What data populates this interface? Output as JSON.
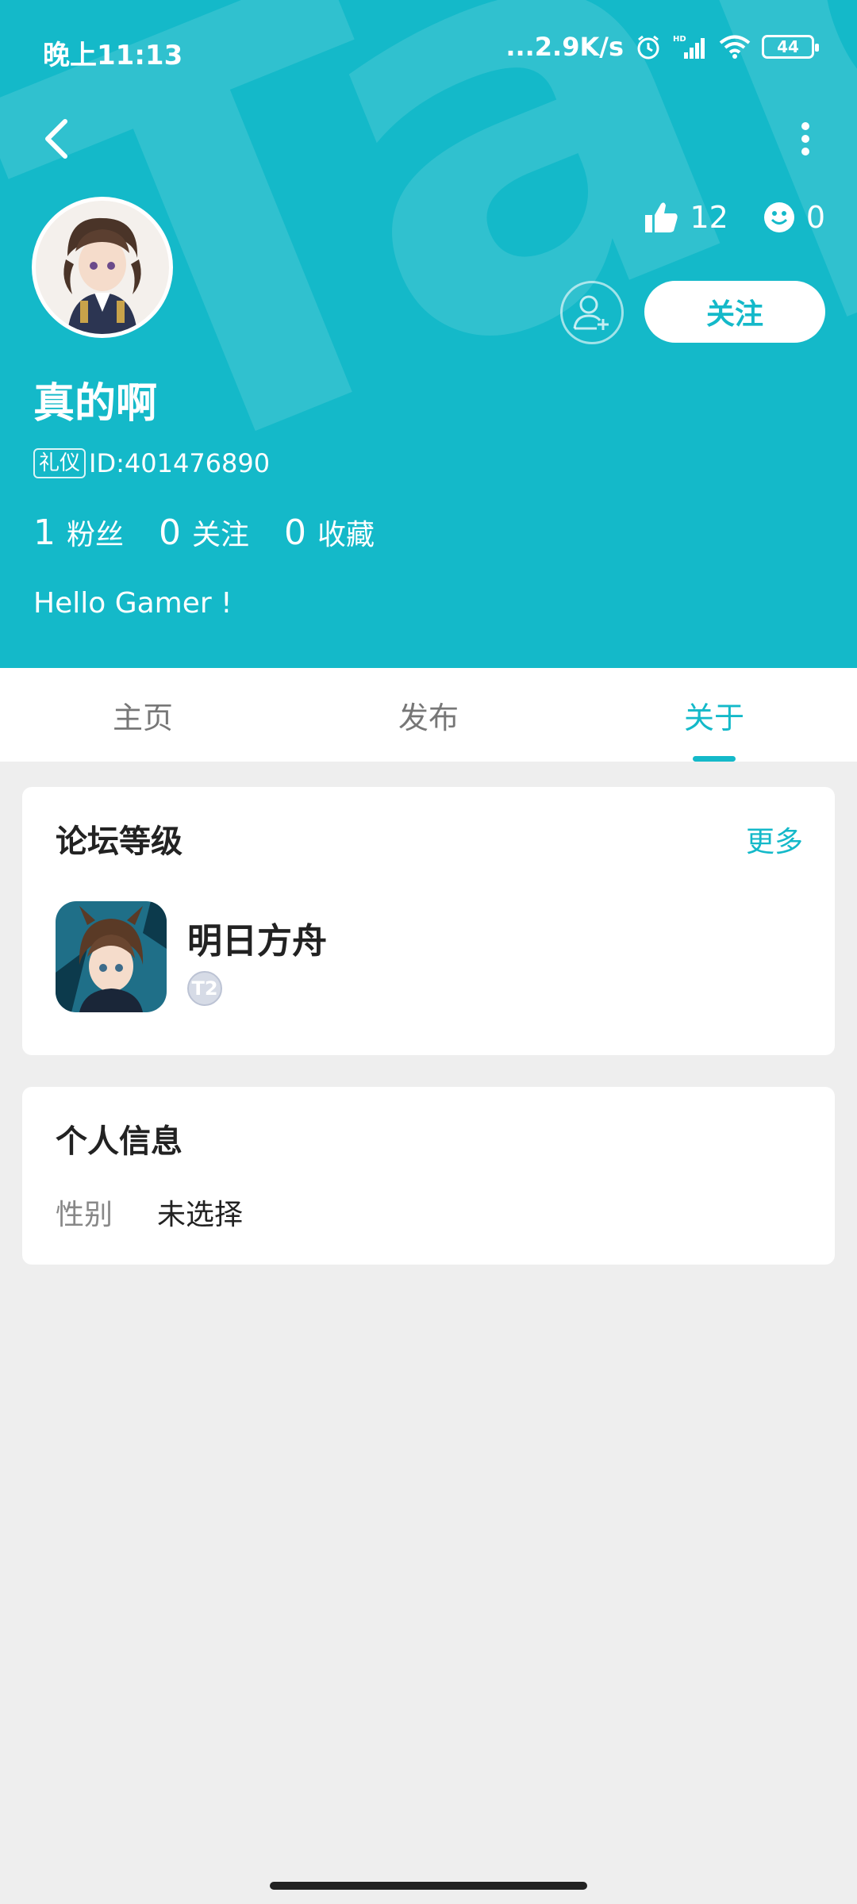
{
  "status_bar": {
    "time": "晚上11:13",
    "network_speed": "...2.9K/s",
    "battery": "44",
    "icons": [
      "alarm-icon",
      "hd-signal-icon",
      "wifi-icon",
      "battery-icon"
    ]
  },
  "header": {
    "watermark": "TapTap",
    "likes": "12",
    "emoji_count": "0",
    "follow_label": "关注",
    "username": "真的啊",
    "badge": "礼仪",
    "user_id": "ID:401476890",
    "fans_count": "1",
    "fans_label": "粉丝",
    "following_count": "0",
    "following_label": "关注",
    "favorites_count": "0",
    "favorites_label": "收藏",
    "bio": "Hello Gamer !"
  },
  "tabs": [
    {
      "label": "主页",
      "active": false
    },
    {
      "label": "发布",
      "active": false
    },
    {
      "label": "关于",
      "active": true
    }
  ],
  "forum_level": {
    "title": "论坛等级",
    "more_label": "更多",
    "game_name": "明日方舟",
    "level": "T2"
  },
  "personal_info": {
    "title": "个人信息",
    "gender_label": "性别",
    "gender_value": "未选择"
  },
  "colors": {
    "accent": "#14b9c9",
    "background": "#eeeeee"
  }
}
